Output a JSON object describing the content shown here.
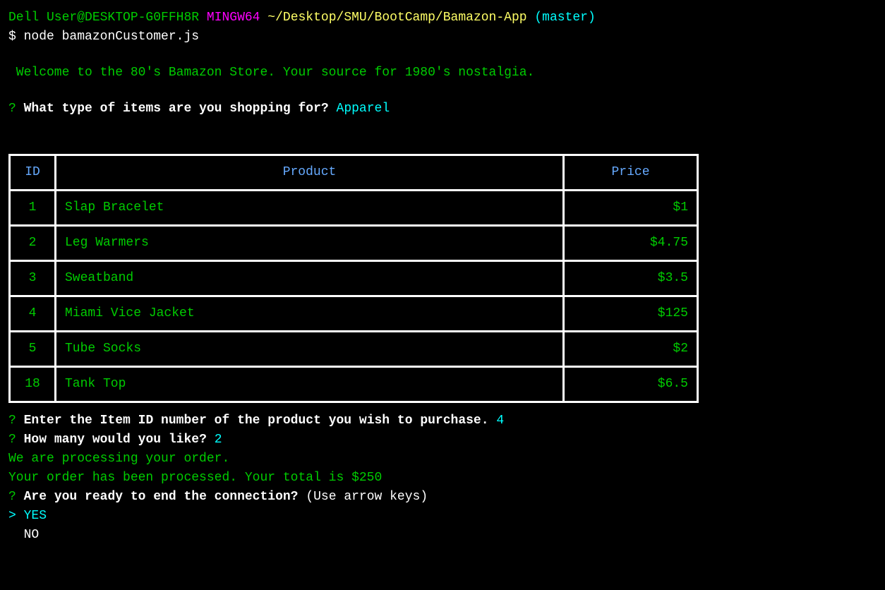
{
  "prompt": {
    "user": "Dell User@DESKTOP-G0FFH8R",
    "shell": "MINGW64",
    "path": "~/Desktop/SMU/BootCamp/Bamazon-App",
    "branch": "(master)",
    "symbol": "$",
    "command": "node bamazonCustomer.js"
  },
  "welcome": " Welcome to the 80's Bamazon Store. Your source for 1980's nostalgia.",
  "q1": {
    "marker": "?",
    "text": "What type of items are you shopping for?",
    "answer": "Apparel"
  },
  "table": {
    "headers": {
      "id": "ID",
      "product": "Product",
      "price": "Price"
    },
    "rows": [
      {
        "id": "1",
        "product": "Slap Bracelet",
        "price": "$1"
      },
      {
        "id": "2",
        "product": "Leg Warmers",
        "price": "$4.75"
      },
      {
        "id": "3",
        "product": "Sweatband",
        "price": "$3.5"
      },
      {
        "id": "4",
        "product": "Miami Vice Jacket",
        "price": "$125"
      },
      {
        "id": "5",
        "product": "Tube Socks",
        "price": "$2"
      },
      {
        "id": "18",
        "product": "Tank Top",
        "price": "$6.5"
      }
    ]
  },
  "q2": {
    "marker": "?",
    "text": "Enter the Item ID number of the product you wish to purchase.",
    "answer": "4"
  },
  "q3": {
    "marker": "?",
    "text": "How many would you like?",
    "answer": "2"
  },
  "processing": "We are processing your order.",
  "processed": "Your order has been processed. Your total is $250",
  "q4": {
    "marker": "?",
    "text": "Are you ready to end the connection?",
    "hint": "(Use arrow keys)"
  },
  "options": [
    {
      "label": "YES",
      "selected": true
    },
    {
      "label": "NO",
      "selected": false
    }
  ]
}
